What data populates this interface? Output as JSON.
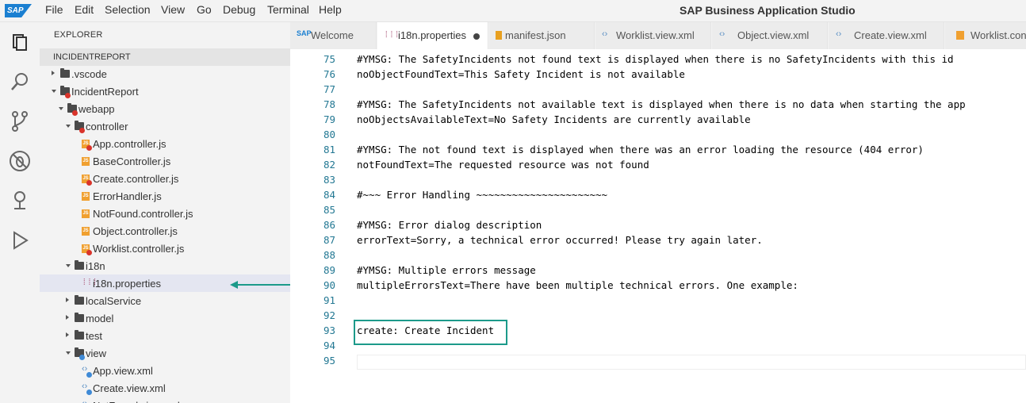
{
  "menubar": {
    "logo": "SAP",
    "items": [
      "File",
      "Edit",
      "Selection",
      "View",
      "Go",
      "Debug",
      "Terminal",
      "Help"
    ],
    "title": "SAP Business Application Studio"
  },
  "activity_bar": [
    "explorer-icon",
    "search-icon",
    "source-control-icon",
    "debug-icon",
    "remote-icon",
    "run-icon"
  ],
  "explorer": {
    "title": "EXPLORER",
    "section": "INCIDENTREPORT",
    "tree": [
      {
        "label": ".vscode",
        "kind": "folder",
        "state": "closed",
        "badge": ""
      },
      {
        "label": "IncidentReport",
        "kind": "folder",
        "state": "open",
        "badge": "error"
      },
      {
        "label": "webapp",
        "kind": "folder",
        "state": "open",
        "badge": "error"
      },
      {
        "label": "controller",
        "kind": "folder",
        "state": "open",
        "badge": "error"
      },
      {
        "label": "App.controller.js",
        "kind": "js",
        "state": "",
        "badge": "error"
      },
      {
        "label": "BaseController.js",
        "kind": "js",
        "state": "",
        "badge": ""
      },
      {
        "label": "Create.controller.js",
        "kind": "js",
        "state": "",
        "badge": "error"
      },
      {
        "label": "ErrorHandler.js",
        "kind": "js",
        "state": "",
        "badge": ""
      },
      {
        "label": "NotFound.controller.js",
        "kind": "js",
        "state": "",
        "badge": ""
      },
      {
        "label": "Object.controller.js",
        "kind": "js",
        "state": "",
        "badge": ""
      },
      {
        "label": "Worklist.controller.js",
        "kind": "js",
        "state": "",
        "badge": "error"
      },
      {
        "label": "i18n",
        "kind": "folder",
        "state": "open",
        "badge": ""
      },
      {
        "label": "i18n.properties",
        "kind": "props",
        "state": "",
        "badge": "",
        "selected": true
      },
      {
        "label": "localService",
        "kind": "folder",
        "state": "closed",
        "badge": ""
      },
      {
        "label": "model",
        "kind": "folder",
        "state": "closed",
        "badge": ""
      },
      {
        "label": "test",
        "kind": "folder",
        "state": "closed",
        "badge": ""
      },
      {
        "label": "view",
        "kind": "folder",
        "state": "open",
        "badge": "info"
      },
      {
        "label": "App.view.xml",
        "kind": "xml",
        "state": "",
        "badge": "info"
      },
      {
        "label": "Create.view.xml",
        "kind": "xml",
        "state": "",
        "badge": "info"
      },
      {
        "label": "NotFound.view.xml",
        "kind": "xml",
        "state": "",
        "badge": ""
      }
    ]
  },
  "tabs": [
    {
      "label": "Welcome",
      "icon": "sap-icon",
      "active": false,
      "dirty": false
    },
    {
      "label": "i18n.properties",
      "icon": "properties-icon",
      "active": true,
      "dirty": true
    },
    {
      "label": "manifest.json",
      "icon": "json-icon",
      "active": false,
      "dirty": false
    },
    {
      "label": "Worklist.view.xml",
      "icon": "xml-icon",
      "active": false,
      "dirty": false
    },
    {
      "label": "Object.view.xml",
      "icon": "xml-icon",
      "active": false,
      "dirty": false
    },
    {
      "label": "Create.view.xml",
      "icon": "xml-icon",
      "active": false,
      "dirty": false
    },
    {
      "label": "Worklist.con",
      "icon": "js-icon",
      "active": false,
      "dirty": false
    }
  ],
  "editor": {
    "lines": [
      {
        "n": "75",
        "text": "#YMSG: The SafetyIncidents not found text is displayed when there is no SafetyIncidents with this id"
      },
      {
        "n": "76",
        "text": "noObjectFoundText=This Safety Incident is not available"
      },
      {
        "n": "77",
        "text": ""
      },
      {
        "n": "78",
        "text": "#YMSG: The SafetyIncidents not available text is displayed when there is no data when starting the app"
      },
      {
        "n": "79",
        "text": "noObjectsAvailableText=No Safety Incidents are currently available"
      },
      {
        "n": "80",
        "text": ""
      },
      {
        "n": "81",
        "text": "#YMSG: The not found text is displayed when there was an error loading the resource (404 error)"
      },
      {
        "n": "82",
        "text": "notFoundText=The requested resource was not found"
      },
      {
        "n": "83",
        "text": ""
      },
      {
        "n": "84",
        "text": "#~~~ Error Handling ~~~~~~~~~~~~~~~~~~~~~~"
      },
      {
        "n": "85",
        "text": ""
      },
      {
        "n": "86",
        "text": "#YMSG: Error dialog description"
      },
      {
        "n": "87",
        "text": "errorText=Sorry, a technical error occurred! Please try again later."
      },
      {
        "n": "88",
        "text": ""
      },
      {
        "n": "89",
        "text": "#YMSG: Multiple errors message"
      },
      {
        "n": "90",
        "text": "multipleErrorsText=There have been multiple technical errors. One example:"
      },
      {
        "n": "91",
        "text": ""
      },
      {
        "n": "92",
        "text": ""
      },
      {
        "n": "93",
        "text": "create: Create Incident"
      },
      {
        "n": "94",
        "text": ""
      },
      {
        "n": "95",
        "text": ""
      }
    ]
  },
  "colors": {
    "accent": "#1c9a8a",
    "line_number": "#237893",
    "error_badge": "#d9342b",
    "info_badge": "#3f8ad6"
  }
}
